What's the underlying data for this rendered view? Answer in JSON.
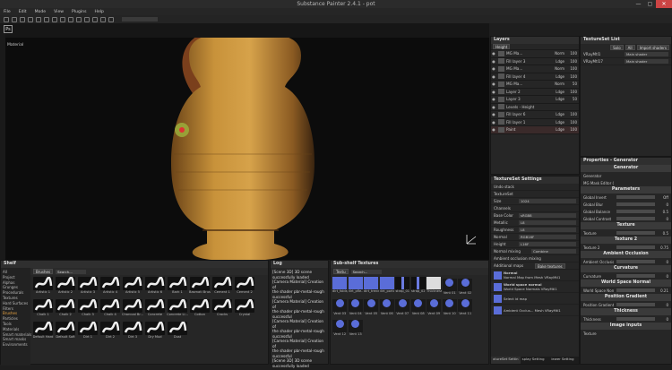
{
  "app": {
    "title": "Substance Painter 2.4.1 - pot",
    "window_buttons": [
      "—",
      "▢",
      "✕"
    ]
  },
  "menu": [
    "File",
    "Edit",
    "Mode",
    "View",
    "Plugins",
    "Help"
  ],
  "viewport": {
    "ps_label": "Ps",
    "material_label": "Material"
  },
  "layers": {
    "title": "Layers",
    "channel": "Height",
    "rows": [
      {
        "name": "MG Ma...",
        "blend": "Norm",
        "op": "100"
      },
      {
        "name": "Fill layer 3",
        "blend": "Ldge",
        "op": "100"
      },
      {
        "name": "MG Ma...",
        "blend": "Norm",
        "op": "100"
      },
      {
        "name": "Fill layer 4",
        "blend": "Ldge",
        "op": "100"
      },
      {
        "name": "MG Ma...",
        "blend": "Norm",
        "op": "50"
      },
      {
        "name": "Layer 2",
        "blend": "Ldge",
        "op": "100"
      },
      {
        "name": "Layer 3",
        "blend": "Ldge",
        "op": "50"
      },
      {
        "name": "Levels - Height",
        "blend": "",
        "op": ""
      },
      {
        "name": "Fill layer 6",
        "blend": "Ldge",
        "op": "100"
      },
      {
        "name": "Fill layer 1",
        "blend": "Ldge",
        "op": "100"
      },
      {
        "name": "Paint",
        "blend": "Ldge",
        "op": "100"
      }
    ]
  },
  "texture_set_list": {
    "title": "TextureSet List",
    "buttons": [
      "Solo",
      "All",
      "Import shaders"
    ],
    "rows": [
      {
        "name": "VRayMtl1",
        "shader": "Main shader"
      },
      {
        "name": "VRayMtl17",
        "shader": "Main shader"
      }
    ]
  },
  "texture_set_settings": {
    "title": "TextureSet Settings",
    "undo": "Undo stack",
    "section": "TextureSet",
    "size_label": "Size",
    "size_value": "1024",
    "channels_label": "Channels",
    "channels": [
      {
        "name": "Base Color",
        "fmt": "sRGB8"
      },
      {
        "name": "Metallic",
        "fmt": "L8"
      },
      {
        "name": "Roughness",
        "fmt": "L8"
      },
      {
        "name": "Normal",
        "fmt": "RGB16F"
      },
      {
        "name": "Height",
        "fmt": "L16F"
      }
    ],
    "normal_mixing_label": "Normal mixing",
    "normal_mixing_value": "Combine",
    "ao_mixing_label": "Ambient occlusion mixing",
    "additional_maps_label": "Additional maps",
    "bake_button": "Bake textures",
    "maps": [
      {
        "name": "Normal",
        "desc": "Normal Map from Mesh VRayMtl1"
      },
      {
        "name": "World space normal",
        "desc": "World Space Normals VRayMtl1"
      },
      {
        "name": "",
        "desc": "Select id map"
      },
      {
        "name": "",
        "desc": "Ambient Occlus...  Mesh VRayMtl1"
      }
    ],
    "bottom_tabs": [
      "xtureSet Settin",
      "splay Setting",
      "iewer Setting"
    ]
  },
  "properties": {
    "title": "Properties - Generator",
    "sections": [
      {
        "header": "Generator",
        "rows": [
          {
            "label": "Generator",
            "value": ""
          },
          {
            "label": "MG Mask Editor (Outdated)",
            "value": ""
          }
        ]
      },
      {
        "header": "Parameters",
        "rows": [
          {
            "label": "Global Invert",
            "value": "Off"
          },
          {
            "label": "Global Blur",
            "value": "0"
          },
          {
            "label": "Global Balance",
            "value": "0.5"
          },
          {
            "label": "Global Contrast",
            "value": "0"
          }
        ]
      },
      {
        "header": "Texture",
        "rows": [
          {
            "label": "Texture",
            "value": "0.5"
          }
        ]
      },
      {
        "header": "Texture 2",
        "rows": [
          {
            "label": "Texture 2",
            "value": "0.75"
          }
        ]
      },
      {
        "header": "Ambient Occlusion",
        "rows": [
          {
            "label": "Ambient Occlusion",
            "value": "0"
          }
        ]
      },
      {
        "header": "Curvature",
        "rows": [
          {
            "label": "Curvature",
            "value": "0"
          }
        ]
      },
      {
        "header": "World Space Normal",
        "rows": [
          {
            "label": "World Space Normal",
            "value": "0.21"
          }
        ]
      },
      {
        "header": "Position Gradient",
        "rows": [
          {
            "label": "Position Gradient",
            "value": "0"
          }
        ]
      },
      {
        "header": "Thickness",
        "rows": [
          {
            "label": "Thickness",
            "value": "0"
          }
        ]
      },
      {
        "header": "Image inputs",
        "rows": [
          {
            "label": "Texture",
            "value": ""
          }
        ]
      }
    ]
  },
  "shelf": {
    "title": "Shelf",
    "search_tag": "Brushes",
    "search_placeholder": "Search...",
    "nav": [
      "All",
      "Project",
      "Alphas",
      "Grunges",
      "Procedurals",
      "Textures",
      "Hard Surfaces",
      "Filters",
      "Brushes",
      "Particles",
      "Tools",
      "Materials",
      "Smart materials",
      "Smart masks",
      "Environments"
    ],
    "selected_nav": "Brushes",
    "items": [
      "Artistic 1",
      "Artistic 2",
      "Artistic 3",
      "Artistic 4",
      "Artistic 5",
      "Artistic 6",
      "Bark 1",
      "Basmati Brush",
      "Cement 1",
      "Cement 2",
      "Chalk 1",
      "Chalk 2",
      "Chalk 3",
      "Chalk 4",
      "Charcoal Br...",
      "Concrete",
      "Concrete Li...",
      "Cotton",
      "Cracks",
      "Crystal",
      "Default Hard",
      "Default Soft",
      "Dirt 1",
      "Dirt 2",
      "Dirt 3",
      "Dry Mud",
      "Dust"
    ]
  },
  "log": {
    "title": "Log",
    "lines": [
      "[Scene 3D] 3D scene",
      "successfully loaded",
      "[Camera Material] Creation of",
      "the shader pbr-metal-rough",
      "successful",
      "[Camera Material] Creation of",
      "the shader pbr-metal-rough",
      "successful",
      "[Camera Material] Creation of",
      "the shader pbr-metal-rough",
      "successful",
      "[Camera Material] Creation of",
      "the shader pbr-metal-rough",
      "successful",
      "[Scene 3D] 3D scene",
      "successfully loaded"
    ]
  },
  "subshelf": {
    "title": "Sub-shelf Textures",
    "search_tag": "Textu",
    "search_placeholder": "Search...",
    "items": [
      "dirt_folds_...",
      "dirt_pfle...",
      "dirt_trend...",
      "dirt_portable...",
      "strap_01",
      "strap_02",
      "Thickness M...",
      "Vent 01",
      "Vent 02",
      "Vent 03",
      "Vent 04",
      "Vent 05",
      "Vent 06",
      "Vent 07",
      "Vent 08",
      "Vent 09",
      "Vent 10",
      "Vent 11",
      "Vent 12",
      "Vent 13"
    ]
  }
}
